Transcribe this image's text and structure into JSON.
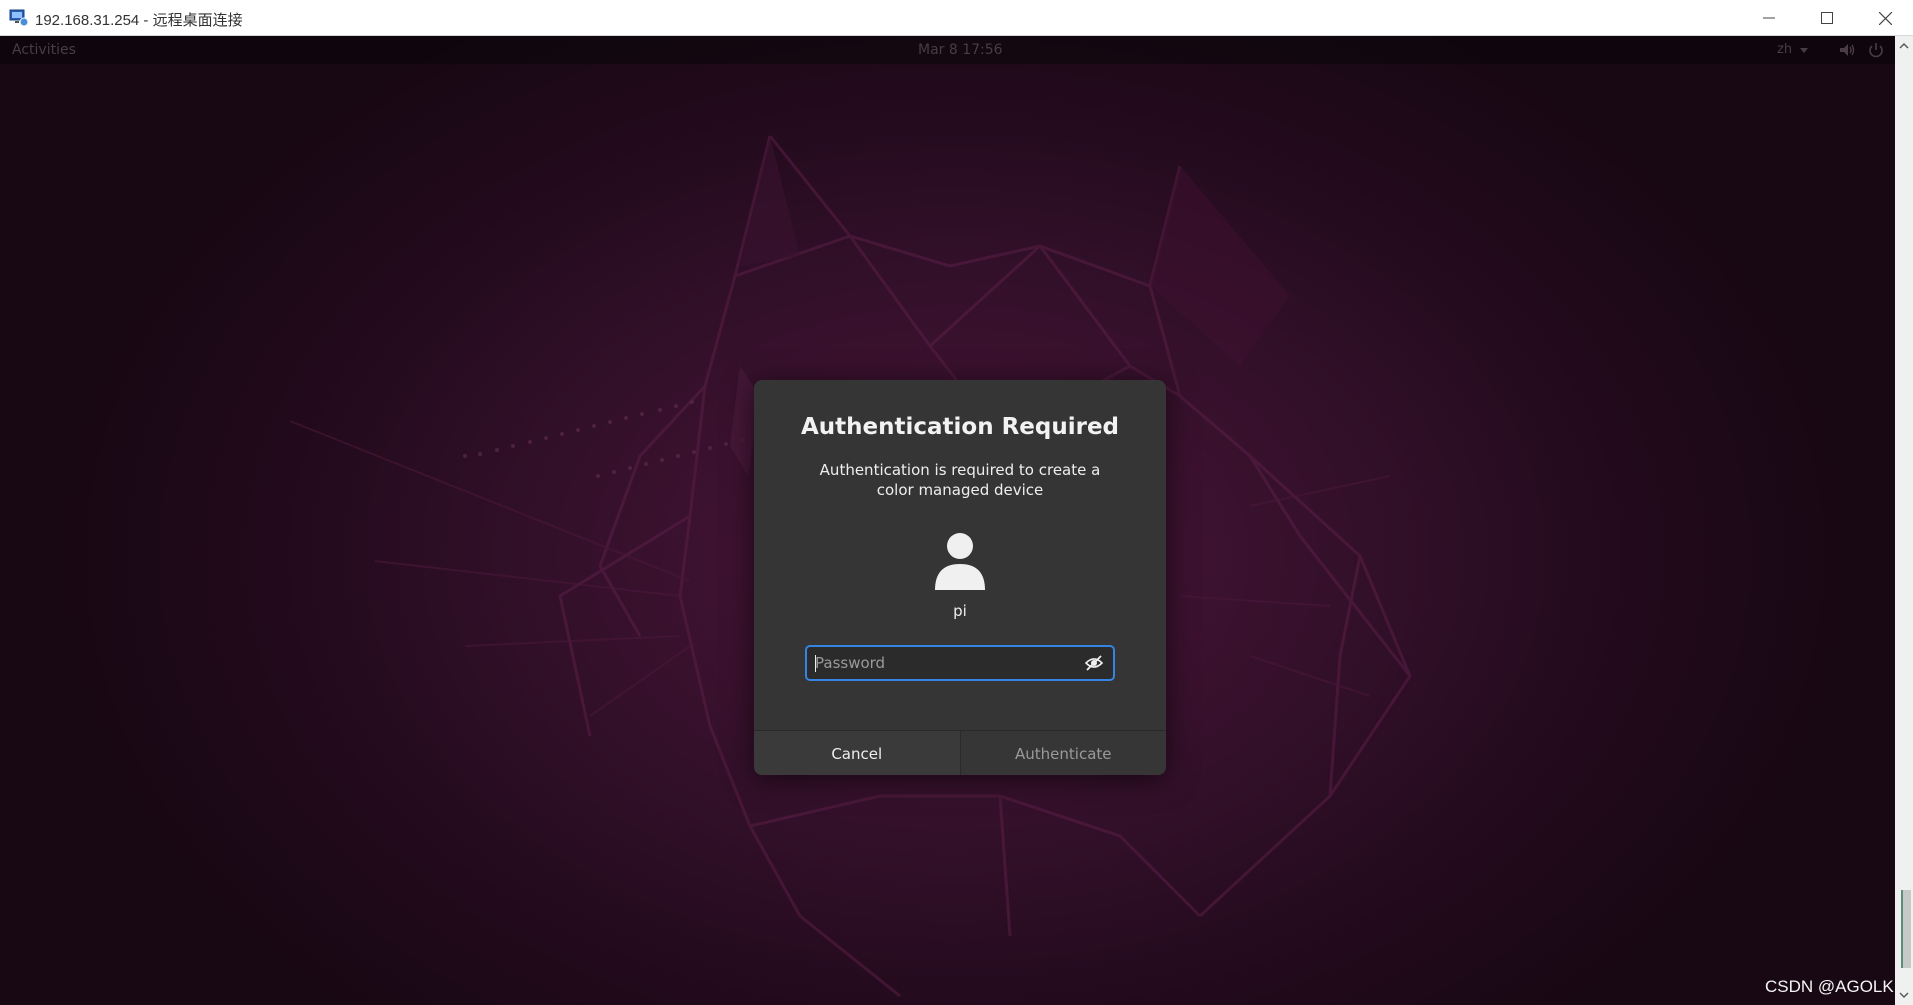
{
  "window": {
    "title": "192.168.31.254 - 远程桌面连接",
    "app_icon": "remote-desktop-icon",
    "controls": [
      "minimize-icon",
      "maximize-icon",
      "close-icon"
    ]
  },
  "topbar": {
    "activities": "Activities",
    "clock": "Mar 8  17:56",
    "language": "zh",
    "icons": [
      "volume-icon",
      "power-icon"
    ]
  },
  "dialog": {
    "title": "Authentication Required",
    "message": "Authentication is required to create a color managed device",
    "user": "pi",
    "avatar_icon": "user-avatar-icon",
    "password": {
      "placeholder": "Password",
      "value": "",
      "reveal_icon": "reveal-password-icon"
    },
    "buttons": {
      "cancel": "Cancel",
      "authenticate": "Authenticate"
    },
    "accent_color": "#3584e4"
  },
  "watermark": "CSDN @AGOLK"
}
